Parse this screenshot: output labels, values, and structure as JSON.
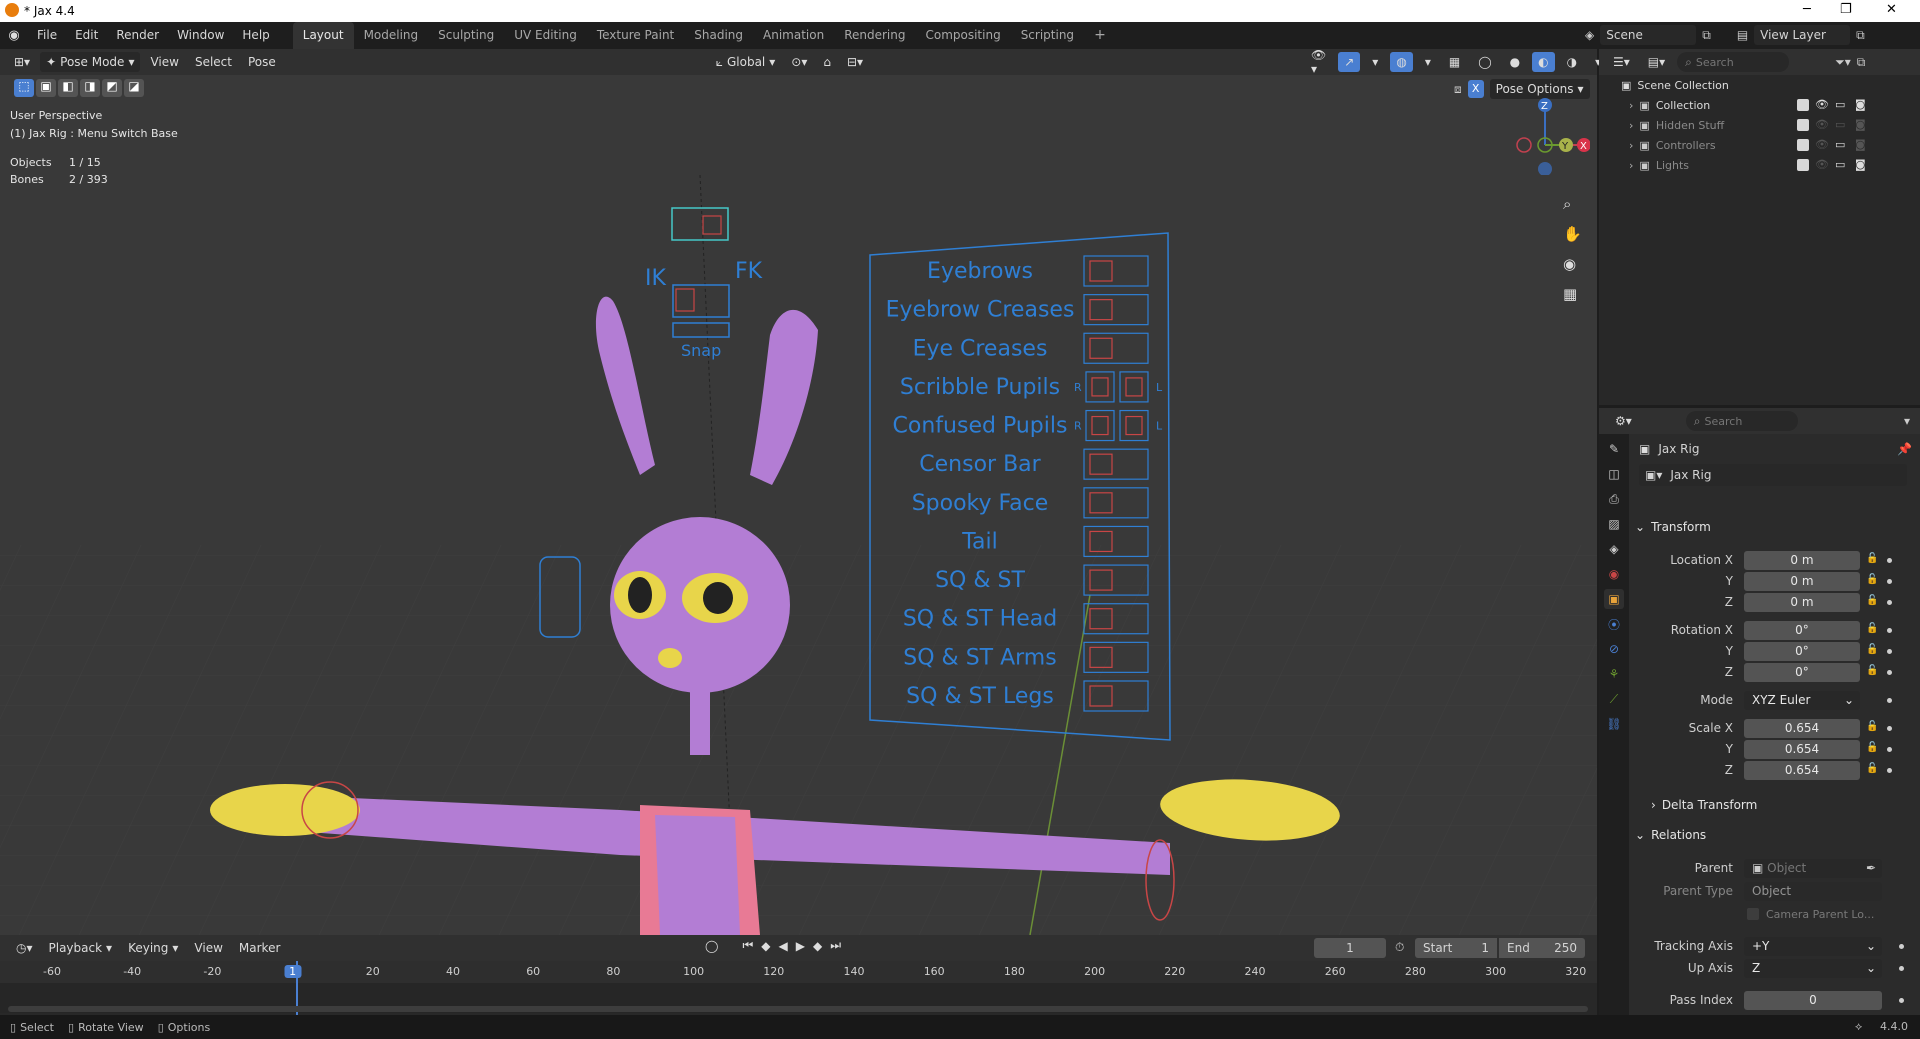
{
  "window": {
    "title": "* Jax 4.4"
  },
  "menus": [
    "File",
    "Edit",
    "Render",
    "Window",
    "Help"
  ],
  "workspaces": [
    "Layout",
    "Modeling",
    "Sculpting",
    "UV Editing",
    "Texture Paint",
    "Shading",
    "Animation",
    "Rendering",
    "Compositing",
    "Scripting"
  ],
  "active_workspace": "Layout",
  "top_right": {
    "scene": "Scene",
    "view_layer": "View Layer"
  },
  "viewport_header": {
    "mode": "Pose Mode",
    "menus": [
      "View",
      "Select",
      "Pose"
    ],
    "transform_orientation": "Global",
    "pose_options": "Pose Options",
    "x_mirror": "X"
  },
  "viewport_overlay": {
    "perspective": "User Perspective",
    "active": "(1) Jax Rig : Menu Switch Base",
    "objects_label": "Objects",
    "objects_value": "1 / 15",
    "bones_label": "Bones",
    "bones_value": "2 / 393"
  },
  "gizmo": {
    "z": "Z",
    "y": "Y",
    "x": "X"
  },
  "rig_menu": {
    "ik": "IK",
    "fk": "FK",
    "snap": "Snap",
    "items": [
      "Eyebrows",
      "Eyebrow Creases",
      "Eye Creases",
      "Scribble Pupils",
      "Confused Pupils",
      "Censor Bar",
      "Spooky Face",
      "Tail",
      "SQ & ST",
      "SQ & ST Head",
      "SQ & ST Arms",
      "SQ & ST Legs"
    ],
    "r": "R",
    "l": "L"
  },
  "outliner": {
    "search_placeholder": "Search",
    "root": "Scene Collection",
    "collections": [
      {
        "name": "Collection"
      },
      {
        "name": "Hidden Stuff"
      },
      {
        "name": "Controllers"
      },
      {
        "name": "Lights"
      }
    ]
  },
  "properties": {
    "search_placeholder": "Search",
    "object_name": "Jax Rig",
    "data_name": "Jax Rig",
    "transform_label": "Transform",
    "location_x_label": "Location X",
    "location_y_label": "Y",
    "location_z_label": "Z",
    "location_x": "0 m",
    "location_y": "0 m",
    "location_z": "0 m",
    "rotation_x_label": "Rotation X",
    "rotation_y_label": "Y",
    "rotation_z_label": "Z",
    "rotation_x": "0°",
    "rotation_y": "0°",
    "rotation_z": "0°",
    "mode_label": "Mode",
    "mode_value": "XYZ Euler",
    "scale_x_label": "Scale X",
    "scale_y_label": "Y",
    "scale_z_label": "Z",
    "scale_x": "0.654",
    "scale_y": "0.654",
    "scale_z": "0.654",
    "delta_transform_label": "Delta Transform",
    "relations_label": "Relations",
    "parent_label": "Parent",
    "parent_placeholder": "Object",
    "parent_type_label": "Parent Type",
    "parent_type_value": "Object",
    "camera_parent_label": "Camera Parent Lo...",
    "tracking_axis_label": "Tracking Axis",
    "tracking_axis_value": "+Y",
    "up_axis_label": "Up Axis",
    "up_axis_value": "Z",
    "pass_index_label": "Pass Index",
    "pass_index_value": "0"
  },
  "timeline": {
    "menus": [
      "Playback",
      "Keying",
      "View",
      "Marker"
    ],
    "current_frame": "1",
    "start_label": "Start",
    "start_value": "1",
    "end_label": "End",
    "end_value": "250",
    "ruler": [
      "-60",
      "-40",
      "-20",
      "1",
      "20",
      "40",
      "60",
      "80",
      "100",
      "120",
      "140",
      "160",
      "180",
      "200",
      "220",
      "240",
      "260",
      "280",
      "300",
      "320"
    ]
  },
  "statusbar": {
    "select": "Select",
    "rotate_view": "Rotate View",
    "options": "Options",
    "version": "4.4.0"
  },
  "colors": {
    "rig_blue": "#2f7fd4",
    "body_purple": "#b37dd4",
    "hand_yellow": "#e8d54a",
    "suit_pink": "#e87a95",
    "active_blue": "#4a7fd1"
  }
}
